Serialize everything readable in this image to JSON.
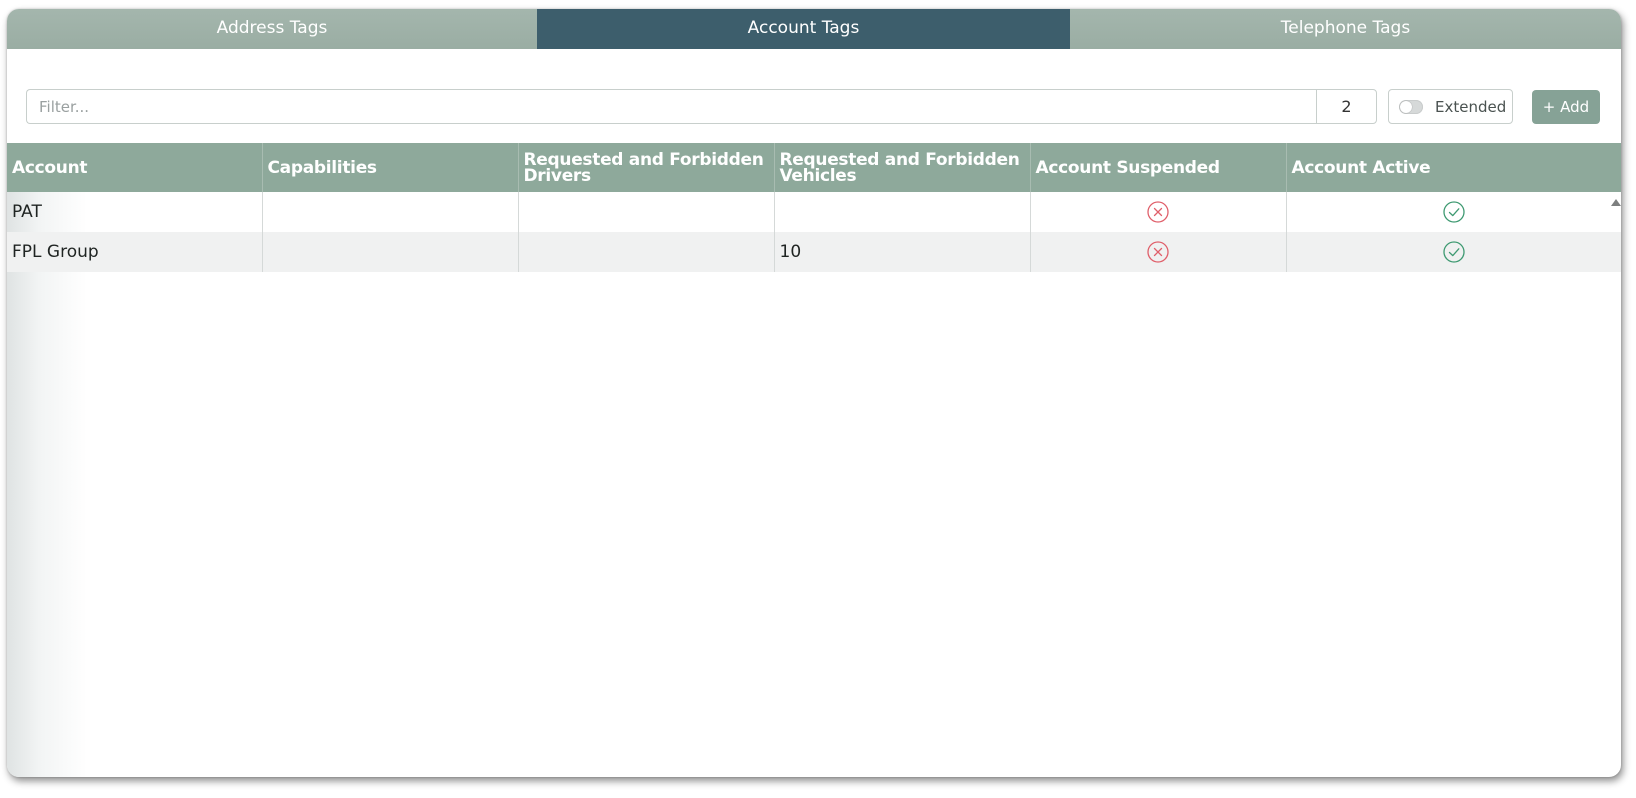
{
  "tabs": [
    {
      "label": "Address Tags",
      "active": false
    },
    {
      "label": "Account Tags",
      "active": true
    },
    {
      "label": "Telephone Tags",
      "active": false
    }
  ],
  "toolbar": {
    "filter_placeholder": "Filter...",
    "filter_value": "",
    "count": "2",
    "extended_label": "Extended",
    "extended_on": false,
    "add_label": "+ Add"
  },
  "table": {
    "columns": [
      "Account",
      "Capabilities",
      "Requested and Forbidden Drivers",
      "Requested and Forbidden Vehicles",
      "Account Suspended",
      "Account Active"
    ],
    "rows": [
      {
        "account": "PAT",
        "capabilities": "",
        "drivers": "",
        "vehicles": "",
        "suspended": "x-circle-icon",
        "active": "check-circle-icon"
      },
      {
        "account": "FPL Group",
        "capabilities": "",
        "drivers": "",
        "vehicles": "10",
        "suspended": "x-circle-icon",
        "active": "check-circle-icon"
      }
    ]
  },
  "colors": {
    "tab_active": "#3d5e6c",
    "tab_inactive": "#9fb2a8",
    "header_bg": "#8ea99b",
    "add_button": "#86a296",
    "status_false": "#e0606b",
    "status_true": "#3f9a72"
  }
}
